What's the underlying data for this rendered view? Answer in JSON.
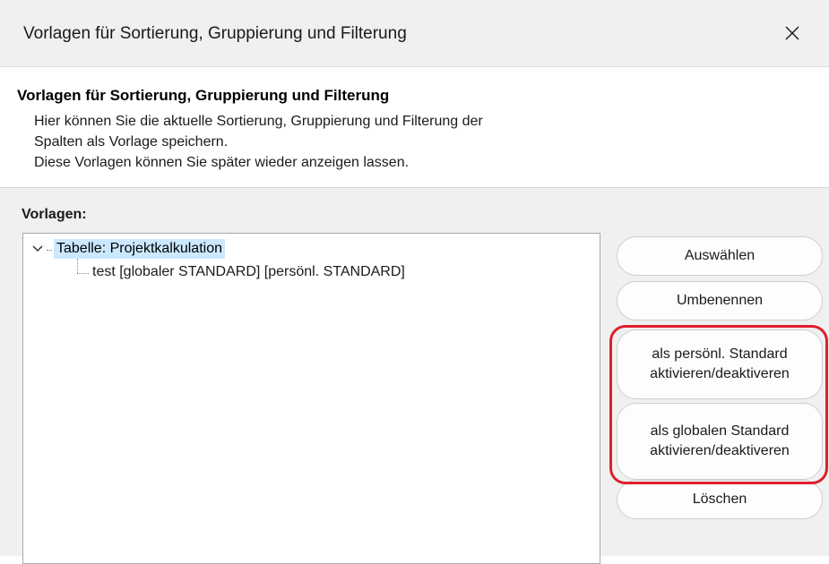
{
  "window": {
    "title": "Vorlagen für Sortierung, Gruppierung und Filterung",
    "close_icon": "close-icon"
  },
  "info": {
    "heading": "Vorlagen für Sortierung, Gruppierung und Filterung",
    "lines": [
      "Hier können Sie die aktuelle Sortierung, Gruppierung und Filterung der",
      "Spalten als Vorlage speichern.",
      "Diese Vorlagen können Sie später wieder anzeigen lassen."
    ]
  },
  "templates": {
    "label": "Vorlagen:",
    "tree": {
      "root": {
        "label": "Tabelle: Projektkalkulation",
        "expanded": true,
        "selected": true,
        "children": [
          {
            "label": "test [globaler STANDARD] [persönl. STANDARD]"
          }
        ]
      }
    }
  },
  "buttons": {
    "select": "Auswählen",
    "rename": "Umbenennen",
    "personal_default": [
      "als persönl. Standard",
      "aktivieren/deaktiveren"
    ],
    "global_default": [
      "als globalen Standard",
      "aktivieren/deaktiveren"
    ],
    "delete": "Löschen"
  },
  "colors": {
    "highlight_border": "#e0202a",
    "selection_bg": "#cce8ff",
    "dialog_bg": "#f0f0f0"
  }
}
